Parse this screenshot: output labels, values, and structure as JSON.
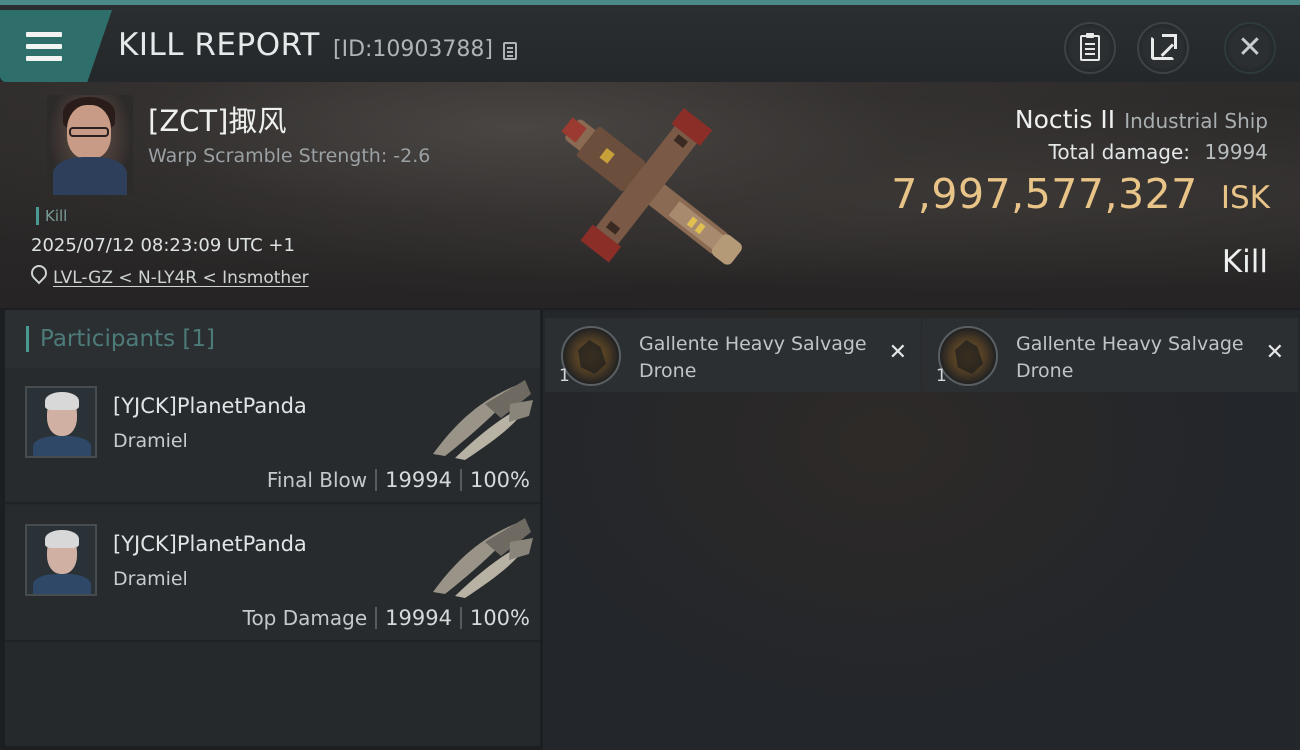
{
  "header": {
    "title": "KILL REPORT",
    "report_id": "[ID:10903788]"
  },
  "victim": {
    "pilot": "[ZCT]掫风",
    "warp_scramble": "Warp Scramble Strength: -2.6",
    "kill_tag": "Kill",
    "datetime": "2025/07/12 08:23:09 UTC +1",
    "location": "LVL-GZ < N-LY4R < Insmother",
    "ship_name": "Noctis II",
    "ship_class": "Industrial Ship",
    "total_damage_label": "Total damage:",
    "total_damage_value": "19994",
    "isk_value": "7,997,577,327",
    "isk_unit": "ISK",
    "result": "Kill"
  },
  "participants": {
    "header": "Participants [1]",
    "rows": [
      {
        "name": "[YJCK]PlanetPanda",
        "ship": "Dramiel",
        "label": "Final Blow",
        "damage": "19994",
        "percent": "100%"
      },
      {
        "name": "[YJCK]PlanetPanda",
        "ship": "Dramiel",
        "label": "Top Damage",
        "damage": "19994",
        "percent": "100%"
      }
    ]
  },
  "items": [
    {
      "name": "Gallente Heavy Salvage Drone",
      "qty": "1",
      "icon": "drone-icon"
    },
    {
      "name": "Gallente Heavy Salvage Drone",
      "qty": "1",
      "icon": "drone-icon"
    }
  ],
  "icons": {
    "menu": "menu-icon",
    "copy": "copy-icon",
    "clipboard": "clipboard-icon",
    "share": "share-icon",
    "close": "close-icon",
    "location": "location-pin-icon"
  },
  "colors": {
    "accent": "#4a9a94",
    "isk": "#e9c488",
    "menu_tab": "#2f6f6b"
  }
}
